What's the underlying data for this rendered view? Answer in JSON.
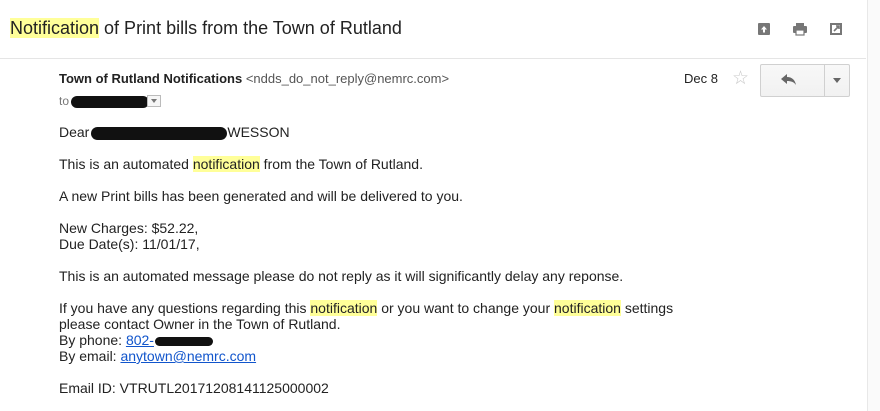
{
  "subject": {
    "highlight": "Notification",
    "rest": " of Print bills from the Town of Rutland"
  },
  "toolbar_icons": [
    "archive-icon",
    "print-icon",
    "new-window-icon"
  ],
  "header": {
    "sender_name": "Town of Rutland Notifications",
    "sender_email": "<ndds_do_not_reply@nemrc.com>",
    "to_label": "to",
    "date": "Dec 8",
    "star": "☆"
  },
  "body": {
    "greeting_prefix": "Dear",
    "greeting_suffix": "WESSON",
    "line1_a": "This is an automated ",
    "line1_hl": "notification",
    "line1_b": " from the Town of Rutland.",
    "line2": "A new Print bills has been generated and will be delivered to you.",
    "charges": "New Charges: $52.22,",
    "due": "Due Date(s): 11/01/17,",
    "noreply": "This is an automated message please do not reply as it will significantly delay any reponse.",
    "q_a": "If you have any questions regarding this ",
    "q_hl1": "notification",
    "q_b": " or you want to change your ",
    "q_hl2": "notification",
    "q_c": " settings",
    "contact": "please contact Owner in the Town of Rutland.",
    "phone_label": "By phone: ",
    "phone_link": "802-",
    "email_label": "By email: ",
    "email_link": "anytown@nemrc.com",
    "email_id": "Email ID: VTRUTL20171208141125000002"
  },
  "colors": {
    "highlight": "#ffff99",
    "link": "#1155cc"
  }
}
